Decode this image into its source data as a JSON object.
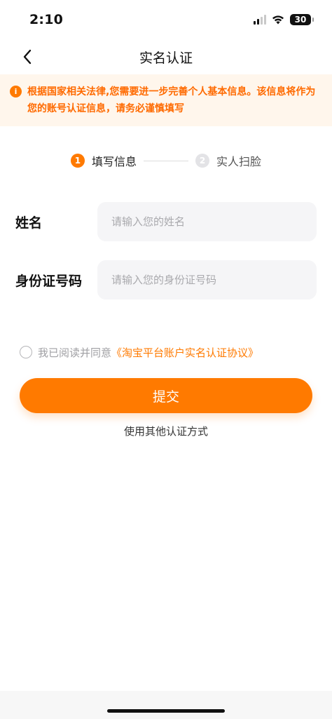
{
  "status_bar": {
    "time": "2:10",
    "battery": "30",
    "icons": [
      "signal-icon",
      "wifi-icon",
      "battery-icon"
    ]
  },
  "nav": {
    "title": "实名认证",
    "back_icon": "chevron-left-icon"
  },
  "notice": {
    "icon": "info-icon",
    "icon_glyph": "i",
    "text": "根据国家相关法律,您需要进一步完善个人基本信息。该信息将作为您的账号认证信息，请务必谨慎填写"
  },
  "steps": [
    {
      "num": "1",
      "label": "填写信息",
      "active": true
    },
    {
      "num": "2",
      "label": "实人扫脸",
      "active": false
    }
  ],
  "form": {
    "name": {
      "label": "姓名",
      "placeholder": "请输入您的姓名",
      "value": ""
    },
    "id_number": {
      "label": "身份证号码",
      "placeholder": "请输入您的身份证号码",
      "value": ""
    }
  },
  "agreement": {
    "text": "我已阅读并同意",
    "link": "《淘宝平台账户实名认证协议》",
    "checked": false
  },
  "submit": {
    "label": "提交"
  },
  "alt_method": {
    "label": "使用其他认证方式"
  },
  "colors": {
    "accent": "#ff7a00",
    "notice_bg": "#fff6ec",
    "input_bg": "#f5f5f7"
  }
}
